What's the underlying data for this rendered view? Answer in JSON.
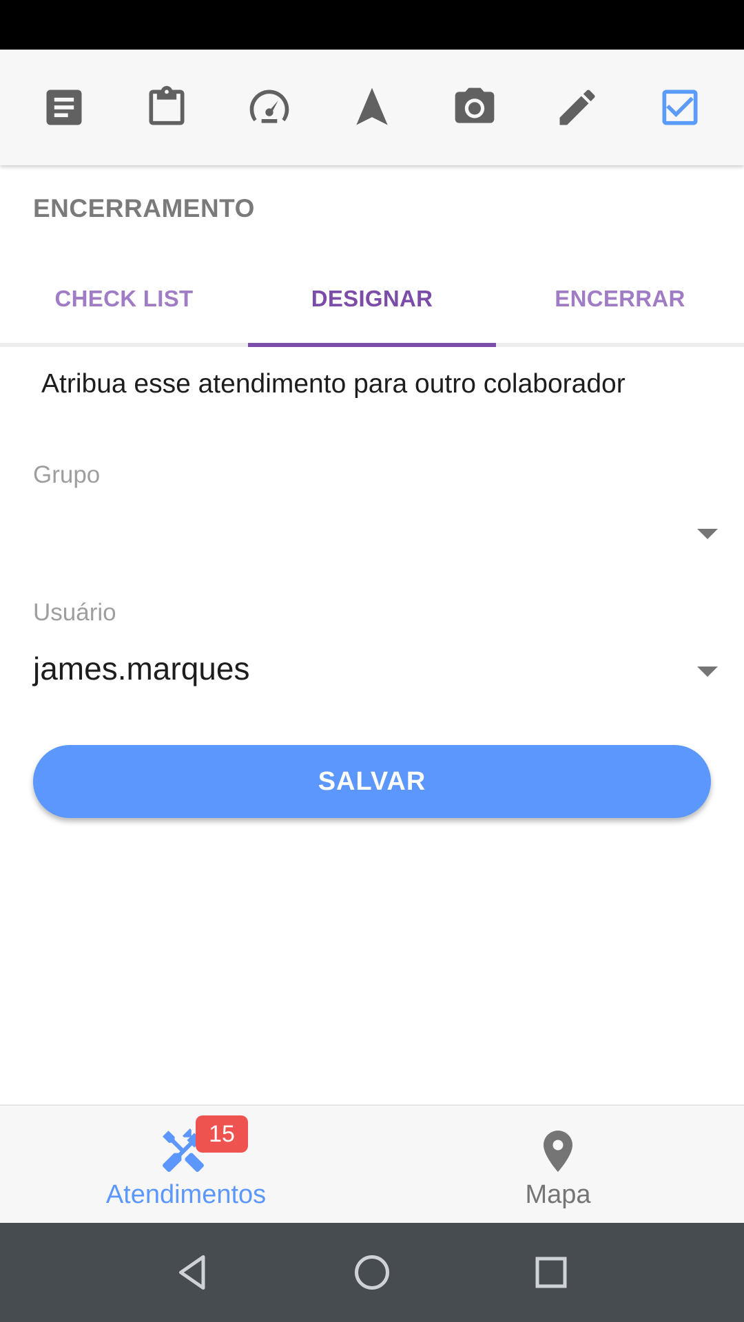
{
  "toolbar": {
    "icons": [
      "document-icon",
      "clipboard-icon",
      "speedometer-icon",
      "navigation-arrow-icon",
      "camera-icon",
      "pencil-icon",
      "checkbox-checked-icon"
    ],
    "active_icon": "checkbox-checked-icon"
  },
  "section": {
    "title": "ENCERRAMENTO"
  },
  "tabs": [
    {
      "label": "CHECK LIST",
      "active": false
    },
    {
      "label": "DESIGNAR",
      "active": true
    },
    {
      "label": "ENCERRAR",
      "active": false
    }
  ],
  "form": {
    "instruction": "Atribua esse atendimento para outro colaborador",
    "group": {
      "label": "Grupo",
      "value": ""
    },
    "user": {
      "label": "Usuário",
      "value": "james.marques"
    },
    "save_label": "SALVAR"
  },
  "bottom_nav": {
    "items": [
      {
        "label": "Atendimentos",
        "icon": "wrench-screwdriver-icon",
        "badge": "15",
        "active": true
      },
      {
        "label": "Mapa",
        "icon": "map-pin-icon",
        "active": false
      }
    ]
  },
  "system_nav": {
    "icons": [
      "back-icon",
      "home-icon",
      "recents-icon"
    ]
  },
  "colors": {
    "accent": "#5b97fc",
    "tab_active": "#7b4ca8",
    "tab_inactive": "#a07cc5",
    "badge": "#ef5350",
    "status_bar": "#000000",
    "system_nav": "#474c51"
  }
}
